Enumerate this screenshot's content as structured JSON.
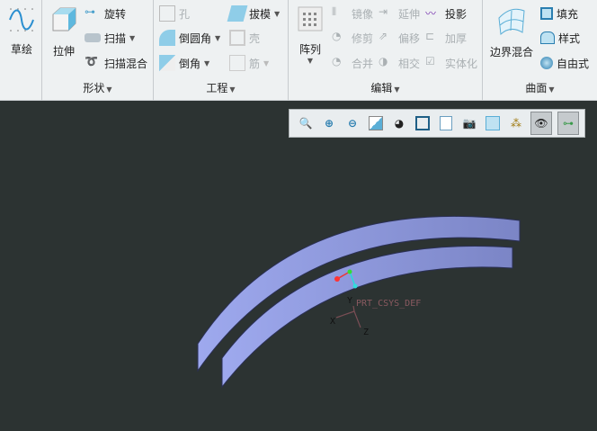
{
  "ribbon": {
    "sketch": {
      "label": "草绘"
    },
    "shape": {
      "group": "形状",
      "extrude": "拉伸",
      "revolve": "旋转",
      "sweep": "扫描",
      "swept_blend": "扫描混合"
    },
    "engineering": {
      "group": "工程",
      "hole": "孔",
      "draft": "拔模",
      "round": "倒圆角",
      "shell": "壳",
      "chamfer": "倒角",
      "rib": "筋"
    },
    "editing": {
      "group": "编辑",
      "pattern": "阵列",
      "mirror": "镜像",
      "extend": "延伸",
      "project": "投影",
      "trim": "修剪",
      "offset": "偏移",
      "thicken": "加厚",
      "merge": "合并",
      "intersect": "相交",
      "solidify": "实体化"
    },
    "surfaces": {
      "group": "曲面",
      "boundary_blend": "边界混合",
      "fill": "填充",
      "style": "样式",
      "freestyle": "自由式"
    }
  },
  "viewport": {
    "csys_label": "PRT_CSYS_DEF",
    "axis_x": "X",
    "axis_y": "Y",
    "axis_z": "Z",
    "bg": "#2c3332",
    "surface_color": "#8e98e0"
  }
}
